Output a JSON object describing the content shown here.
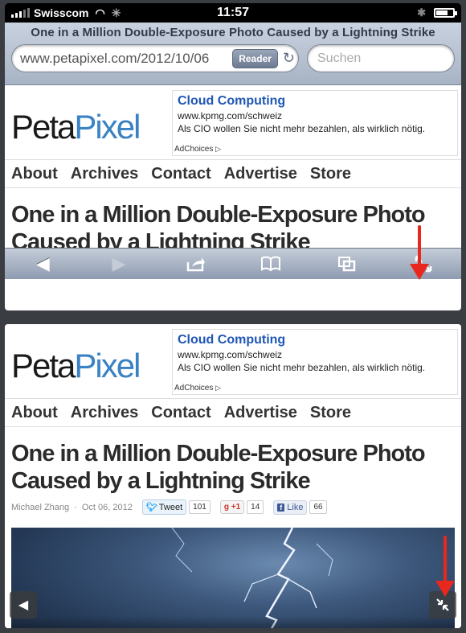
{
  "status": {
    "carrier": "Swisscom",
    "time": "11:57"
  },
  "browser": {
    "page_title": "One in a Million Double-Exposure Photo Caused by a Lightning Strike",
    "url": "www.petapixel.com/2012/10/06",
    "reader_label": "Reader",
    "search_placeholder": "Suchen"
  },
  "site": {
    "logo_peta": "Peta",
    "logo_pixel": "Pixel",
    "ad": {
      "title": "Cloud Computing",
      "url": "www.kpmg.com/schweiz",
      "text": "Als CIO wollen Sie nicht mehr bezahlen, als wirklich nötig.",
      "choices": "AdChoices"
    },
    "nav": [
      "About",
      "Archives",
      "Contact",
      "Advertise",
      "Store"
    ],
    "headline_line1": "One in a Million Double-Exposure Photo",
    "headline_line2": "Caused by a Lightning Strike",
    "author": "Michael Zhang",
    "date": "Oct 06, 2012",
    "tweet_label": "Tweet",
    "tweet_count": "101",
    "gplus_label": "+1",
    "gplus_count": "14",
    "like_label": "Like",
    "like_count": "66"
  },
  "toolbar": {
    "icons": [
      "back-icon",
      "forward-icon",
      "share-icon",
      "bookmarks-icon",
      "tabs-icon",
      "fullscreen-icon"
    ]
  },
  "colors": {
    "accent_red": "#e8281c",
    "link_blue": "#1f57b5",
    "logo_blue": "#3b82c4"
  }
}
